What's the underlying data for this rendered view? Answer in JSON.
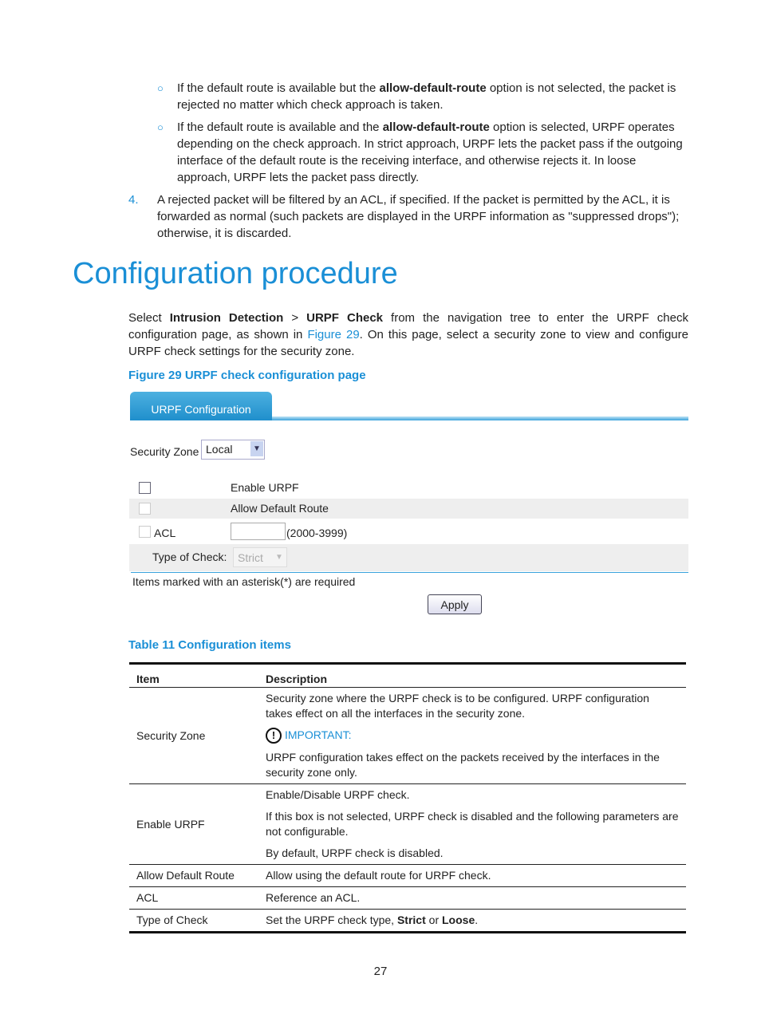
{
  "bullets": [
    {
      "pre": "If the default route is available but the ",
      "bold": "allow-default-route",
      "post": " option is not selected, the packet is rejected no matter which check approach is taken."
    },
    {
      "pre": "If the default route is available and the ",
      "bold": "allow-default-route",
      "post": " option is selected, URPF operates depending on the check approach. In strict approach, URPF lets the packet pass if the outgoing interface of the default route is the receiving interface, and otherwise rejects it. In loose approach, URPF lets the packet pass directly."
    }
  ],
  "step4": {
    "num": "4.",
    "text": "A rejected packet will be filtered by an ACL, if specified. If the packet is permitted by the ACL, it is forwarded as normal (such packets are displayed in the URPF information as \"suppressed drops\"); otherwise, it is discarded."
  },
  "heading": "Configuration procedure",
  "intro": {
    "t1": "Select ",
    "b1": "Intrusion Detection",
    "t2": " > ",
    "b2": "URPF Check",
    "t3": " from the navigation tree to enter the URPF check configuration page, as shown in ",
    "link": "Figure 29",
    "t4": ". On this page, select a security zone to view and configure URPF check settings for the security zone."
  },
  "figure_caption": "Figure 29 URPF check configuration page",
  "ui": {
    "tab": "URPF Configuration",
    "zone_label": "Security Zone",
    "zone_value": "Local",
    "enable": "Enable URPF",
    "allow": "Allow Default Route",
    "acl": "ACL",
    "acl_range": "(2000-3999)",
    "type_label": "Type of Check:",
    "type_value": "Strict",
    "note": "Items marked with an asterisk(*) are required",
    "apply": "Apply"
  },
  "table_caption": "Table 11 Configuration items",
  "table": {
    "headers": [
      "Item",
      "Description"
    ],
    "rows": [
      {
        "item": "Security Zone",
        "d1": "Security zone where the URPF check is to be configured. URPF configuration takes effect on all the interfaces in the security zone.",
        "important": "IMPORTANT:",
        "d2": "URPF configuration takes effect on the packets received by the interfaces in the security zone only."
      },
      {
        "item": "Enable URPF",
        "d1": "Enable/Disable URPF check.",
        "d2": "If this box is not selected, URPF check is disabled and the following parameters are not configurable.",
        "d3": "By default, URPF check is disabled."
      },
      {
        "item": "Allow Default Route",
        "d1": "Allow using the default route for URPF check."
      },
      {
        "item": "ACL",
        "d1": "Reference an ACL."
      },
      {
        "item": "Type of Check",
        "pre": "Set the URPF check type, ",
        "b1": "Strict",
        "mid": " or ",
        "b2": "Loose",
        "post": "."
      }
    ]
  },
  "page_number": "27"
}
